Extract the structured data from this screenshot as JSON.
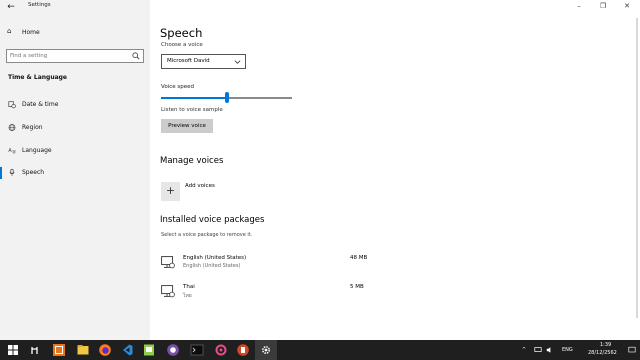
{
  "app": {
    "title": "Settings"
  },
  "nav": {
    "home": "Home",
    "search_placeholder": "Find a setting",
    "section": "Time & Language",
    "items": [
      {
        "label": "Date & time",
        "icon": "clock-calendar-icon"
      },
      {
        "label": "Region",
        "icon": "globe-icon"
      },
      {
        "label": "Language",
        "icon": "language-icon"
      },
      {
        "label": "Speech",
        "icon": "microphone-icon",
        "selected": true
      }
    ]
  },
  "content": {
    "title": "Speech",
    "choose_voice_label": "Choose a voice",
    "voice_selected": "Microsoft David",
    "speed_label": "Voice speed",
    "speed_value": 0.5,
    "listen_label": "Listen to voice sample",
    "preview_button": "Preview voice",
    "manage_title": "Manage voices",
    "add_voices": "Add voices",
    "installed_title": "Installed voice packages",
    "installed_subtitle": "Select a voice package to remove it.",
    "packages": [
      {
        "name": "English (United States)",
        "sub": "English (United States)",
        "size": "48 MB"
      },
      {
        "name": "Thai",
        "sub": "ไทย",
        "size": "5 MB"
      }
    ]
  },
  "taskbar": {
    "icons": [
      "start-icon",
      "search-icon",
      "task-view-icon",
      "file-manager-icon",
      "firefox-icon",
      "vscode-icon",
      "android-studio-icon",
      "screen-recorder-icon",
      "terminal-icon",
      "settings-tool-icon",
      "powerpoint-icon",
      "settings-icon"
    ],
    "lang": "ENG",
    "time": "1:39",
    "date": "28/12/2562"
  },
  "colors": {
    "accent": "#0078d7",
    "taskbar": "#1f1f1f",
    "nav_bg": "#f2f2f2"
  }
}
